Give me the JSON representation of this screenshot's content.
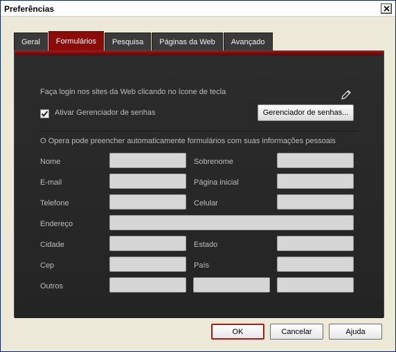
{
  "window": {
    "title": "Preferências",
    "close_label": "×"
  },
  "tabs": [
    {
      "label": "Geral",
      "active": false
    },
    {
      "label": "Formulários",
      "active": true
    },
    {
      "label": "Pesquisa",
      "active": false
    },
    {
      "label": "Páginas da Web",
      "active": false
    },
    {
      "label": "Avançado",
      "active": false
    }
  ],
  "login": {
    "hint": "Faça login nos sites da Web clicando no ícone de tecla",
    "checkbox_label": "Ativar Gerenciador de senhas",
    "checkbox_checked": true,
    "manager_button": "Gerenciador de senhas..."
  },
  "form": {
    "intro": "O Opera pode preencher automaticamente formulários com suas informações pessoais",
    "labels": {
      "nome": "Nome",
      "sobrenome": "Sobrenome",
      "email": "E-mail",
      "pagina_inicial": "Página inicial",
      "telefone": "Telefone",
      "celular": "Celular",
      "endereco": "Endereço",
      "cidade": "Cidade",
      "estado": "Estado",
      "cep": "Cep",
      "pais": "País",
      "outros": "Outros"
    },
    "values": {
      "nome": "",
      "sobrenome": "",
      "email": "",
      "pagina_inicial": "",
      "telefone": "",
      "celular": "",
      "endereco": "",
      "cidade": "",
      "estado": "",
      "cep": "",
      "pais": "",
      "outros1": "",
      "outros2": "",
      "outros3": ""
    }
  },
  "buttons": {
    "ok": "OK",
    "cancel": "Cancelar",
    "help": "Ajuda"
  },
  "colors": {
    "accent": "#8b0a0a",
    "panel": "#2a2a2a",
    "field": "#d6d6d6"
  }
}
